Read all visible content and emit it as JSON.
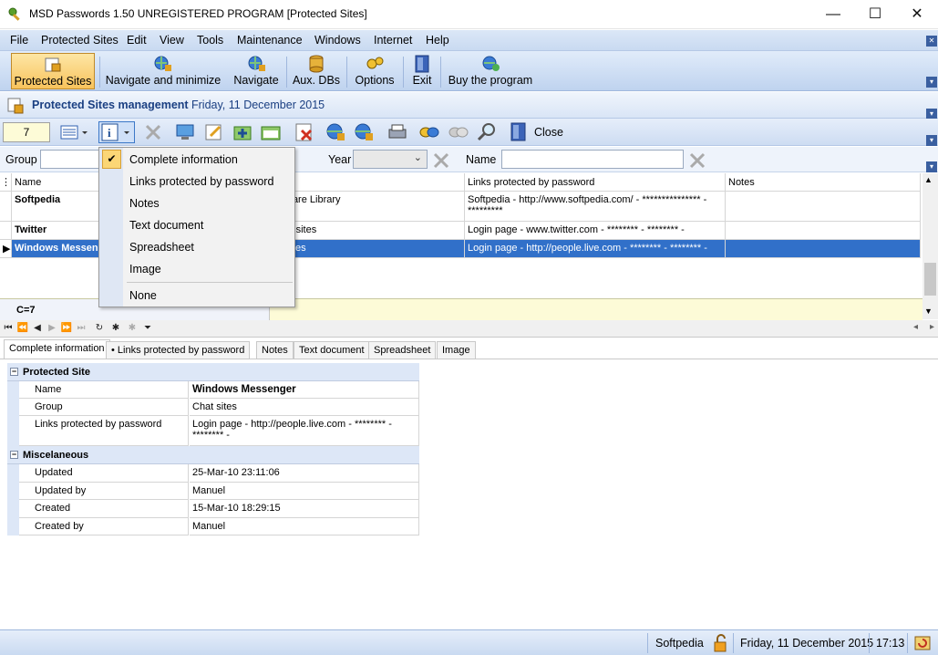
{
  "window": {
    "title": "MSD Passwords 1.50 UNREGISTERED PROGRAM [Protected Sites]",
    "minimize": "—",
    "maximize": "☐",
    "close": "✕"
  },
  "menu": [
    "File",
    "Protected Sites",
    "Edit",
    "View",
    "Tools",
    "Maintenance",
    "Windows",
    "Internet",
    "Help"
  ],
  "toolbar": {
    "protected_sites": "Protected Sites",
    "navigate_minimize": "Navigate and minimize",
    "navigate": "Navigate",
    "aux_dbs": "Aux. DBs",
    "options": "Options",
    "exit": "Exit",
    "buy": "Buy the program"
  },
  "header": {
    "title": "Protected Sites management",
    "date": "Friday, 11 December 2015"
  },
  "toolbar2": {
    "count": "7",
    "close_label": "Close"
  },
  "filter": {
    "group_label": "Group",
    "year_label": "Year",
    "name_label": "Name"
  },
  "grid": {
    "columns": [
      "Name",
      "p",
      "Links protected by password",
      "Notes"
    ],
    "rows": [
      {
        "name": "Softpedia",
        "group": "ware Library",
        "links": "Softpedia - http://www.softpedia.com/ - *************** - *********",
        "notes": ""
      },
      {
        "name": "Twitter",
        "group": "al sites",
        "links": "Login page - www.twitter.com - ******** - ******** -",
        "notes": ""
      },
      {
        "name": "Windows Messenger",
        "group": "sites",
        "links": "Login page - http://people.live.com - ******** - ******** -",
        "notes": ""
      }
    ],
    "count_label": "C=7"
  },
  "tabs": [
    "Complete information",
    "Links protected by password",
    "Notes",
    "Text document",
    "Spreadsheet",
    "Image"
  ],
  "details": {
    "cat1": "Protected Site",
    "name_key": "Name",
    "name_val": "Windows Messenger",
    "group_key": "Group",
    "group_val": "Chat sites",
    "links_key": "Links protected by password",
    "links_val": "Login page - http://people.live.com - ******** - ******** -",
    "cat2": "Miscelaneous",
    "updated_key": "Updated",
    "updated_val": "25-Mar-10 23:11:06",
    "updatedby_key": "Updated by",
    "updatedby_val": "Manuel",
    "created_key": "Created",
    "created_val": "15-Mar-10 18:29:15",
    "createdby_key": "Created by",
    "createdby_val": "Manuel"
  },
  "dropdown": {
    "items": [
      "Complete information",
      "Links protected by password",
      "Notes",
      "Text document",
      "Spreadsheet",
      "Image",
      "None"
    ]
  },
  "status": {
    "user": "Softpedia",
    "date": "Friday, 11 December 2015",
    "time": "17:13"
  },
  "colors": {
    "accent": "#3170c9",
    "header_text": "#1a3f82",
    "toolbar_active": "#f8c35c"
  }
}
